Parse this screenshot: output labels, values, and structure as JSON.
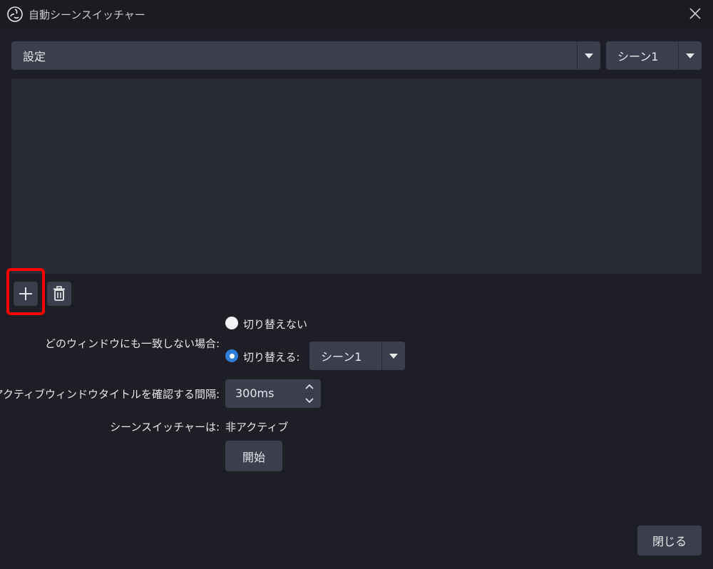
{
  "window": {
    "title": "自動シーンスイッチャー",
    "app_icon": "obs-logo-icon",
    "close_icon": "close-icon"
  },
  "top": {
    "window_select": "設定",
    "scene_select": "シーン1"
  },
  "list_actions": {
    "add_icon": "plus-icon",
    "delete_icon": "trash-icon"
  },
  "no_match": {
    "label": "どのウィンドウにも一致しない場合:",
    "option_dont_switch": "切り替えない",
    "option_switch": "切り替える:",
    "selected_option": "switch",
    "switch_scene": "シーン1"
  },
  "interval": {
    "label": "アクティブウィンドウタイトルを確認する間隔:",
    "value": "300ms"
  },
  "status": {
    "label": "シーンスイッチャーは:",
    "value": "非アクティブ"
  },
  "buttons": {
    "start": "開始",
    "close": "閉じる"
  },
  "colors": {
    "background": "#1e1f26",
    "control": "#3b3f4d",
    "list": "#2a2c35",
    "radio_selected": "#2f7fd6",
    "highlight": "#ff0000"
  }
}
